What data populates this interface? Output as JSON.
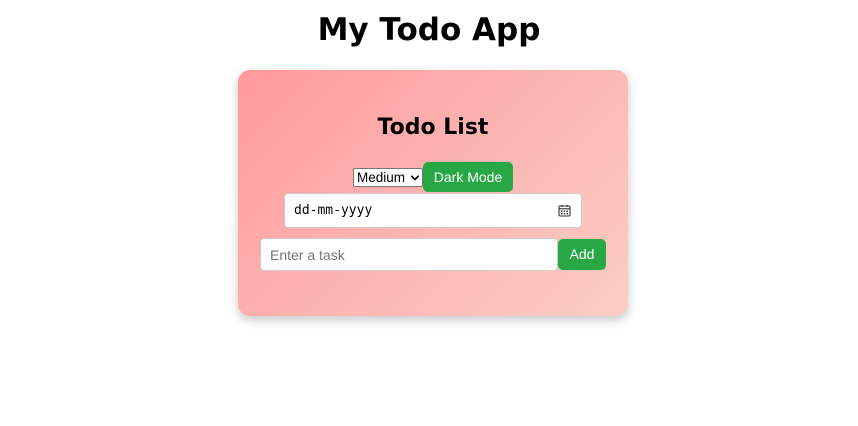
{
  "header": {
    "title": "My Todo App"
  },
  "card": {
    "title": "Todo List",
    "priority_select": {
      "selected": "Medium"
    },
    "dark_mode_label": "Dark Mode",
    "date_input": {
      "placeholder": "dd-mm-yyyy"
    },
    "task_input": {
      "value": "",
      "placeholder": "Enter a task"
    },
    "add_label": "Add"
  },
  "icons": {
    "dropdown": "chevron-down-icon",
    "date": "calendar-icon"
  },
  "colors": {
    "button": "#28a745",
    "card_gradient_start": "#ff9a9e",
    "card_gradient_end": "#fbcdc3"
  }
}
